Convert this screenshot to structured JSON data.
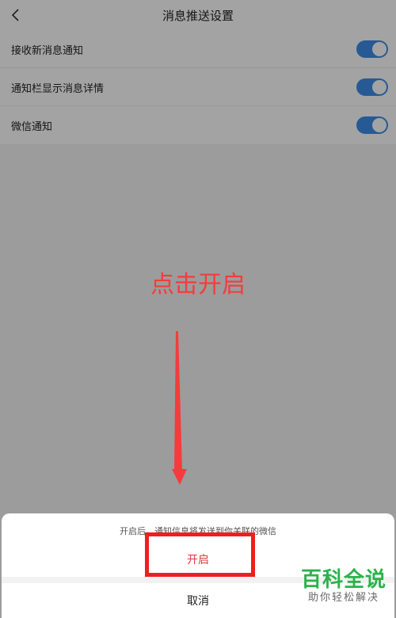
{
  "header": {
    "title": "消息推送设置",
    "back_icon": "chevron-left-icon"
  },
  "settings": [
    {
      "label": "接收新消息通知",
      "enabled": true
    },
    {
      "label": "通知栏显示消息详情",
      "enabled": true
    },
    {
      "label": "微信通知",
      "enabled": true
    }
  ],
  "annotation": {
    "text": "点击开启"
  },
  "sheet": {
    "message": "开启后，通知信息将发送到你关联的微信",
    "confirm_label": "开启",
    "cancel_label": "取消"
  },
  "watermark": {
    "main": "百科全说",
    "sub": "助你轻松解决"
  },
  "colors": {
    "toggle_on": "#3d8ee8",
    "annotation_red": "#f43c3c",
    "confirm_red": "#e03c3c",
    "watermark_green": "#2bb34a"
  }
}
